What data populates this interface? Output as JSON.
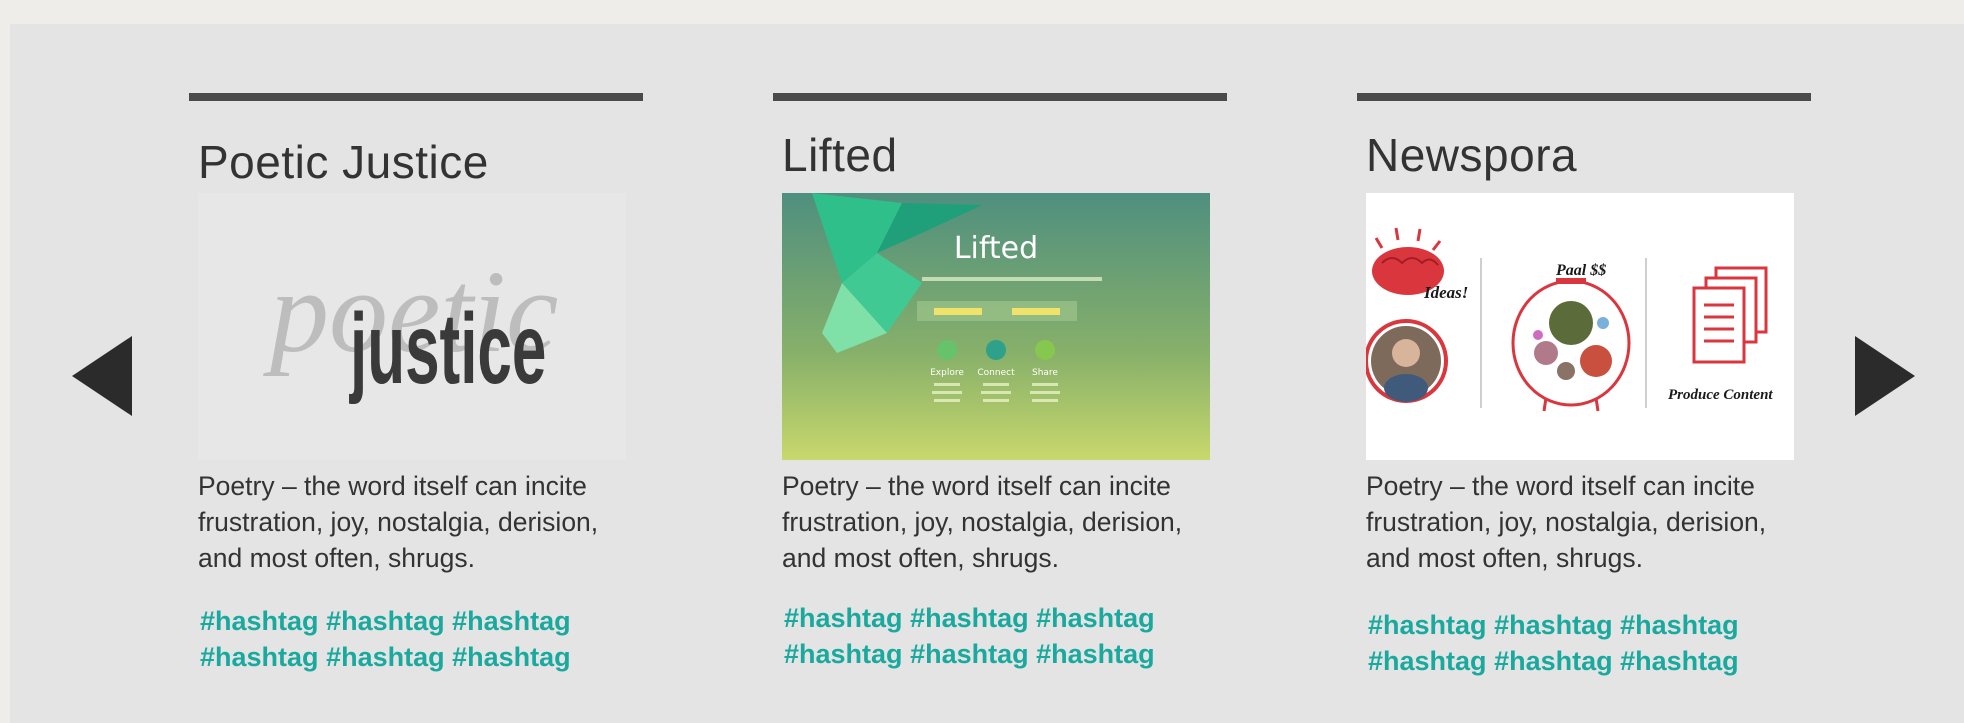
{
  "carousel": {
    "prev_icon": "triangle-left-icon",
    "next_icon": "triangle-right-icon",
    "accent_color": "#1aa99e",
    "rule_color": "#4a4a4a",
    "cards": [
      {
        "title": "Poetic Justice",
        "thumbnail": {
          "script_word": "poetic",
          "block_word": "justice"
        },
        "description": "Poetry – the word itself can incite frustration, joy, nostalgia, derision, and most often, shrugs.",
        "tags": [
          "#hashtag",
          "#hashtag",
          "#hashtag",
          "#hashtag",
          "#hashtag",
          "#hashtag"
        ]
      },
      {
        "title": "Lifted",
        "thumbnail": {
          "logo": "Lifted",
          "columns": [
            "Explore",
            "Connect",
            "Share"
          ]
        },
        "description": "Poetry – the word itself can incite frustration, joy, nostalgia, derision, and most often, shrugs.",
        "tags": [
          "#hashtag",
          "#hashtag",
          "#hashtag",
          "#hashtag",
          "#hashtag",
          "#hashtag"
        ]
      },
      {
        "title": "Newspora",
        "thumbnail": {
          "ideas_label": "Ideas!",
          "money_label": "Paal $$",
          "content_label": "Produce Content"
        },
        "description": "Poetry – the word itself can incite frustration, joy, nostalgia, derision, and most often, shrugs.",
        "tags": [
          "#hashtag",
          "#hashtag",
          "#hashtag",
          "#hashtag",
          "#hashtag",
          "#hashtag"
        ]
      }
    ]
  }
}
